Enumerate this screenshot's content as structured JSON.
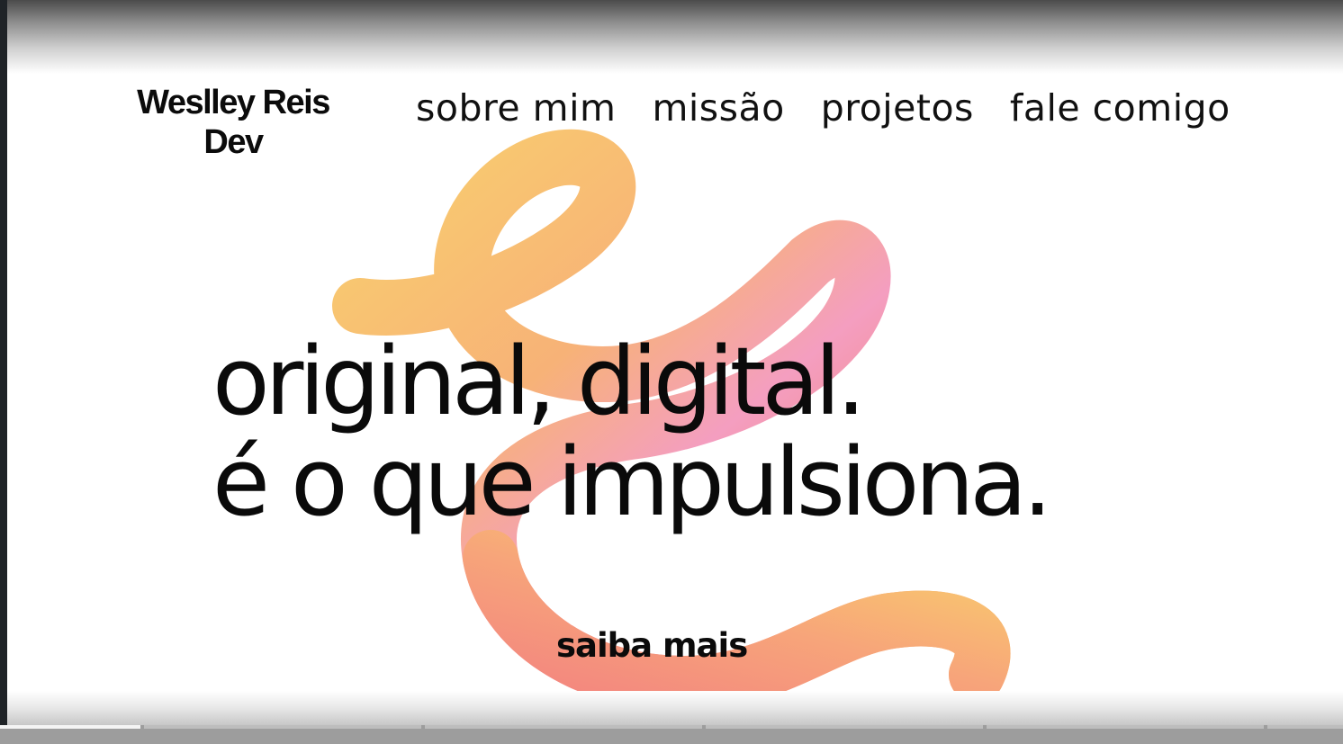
{
  "brand": {
    "line1": "Weslley Reis",
    "line2": "Dev"
  },
  "nav": {
    "items": [
      {
        "label": "sobre mim"
      },
      {
        "label": "missão"
      },
      {
        "label": "projetos"
      },
      {
        "label": "fale comigo"
      }
    ]
  },
  "hero": {
    "line1": "original, digital.",
    "line2": "é o que impulsiona.",
    "cta_label": "saiba mais"
  },
  "colors": {
    "text": "#0a0a0a",
    "background": "#ffffff",
    "ribbon_yellow": "#f9c96e",
    "ribbon_peach": "#f6a07e",
    "ribbon_pink": "#f49ec0",
    "ribbon_coral": "#f2847f"
  },
  "progress": {
    "segments": 5,
    "active_index": 0,
    "active_fraction": 0.5
  }
}
